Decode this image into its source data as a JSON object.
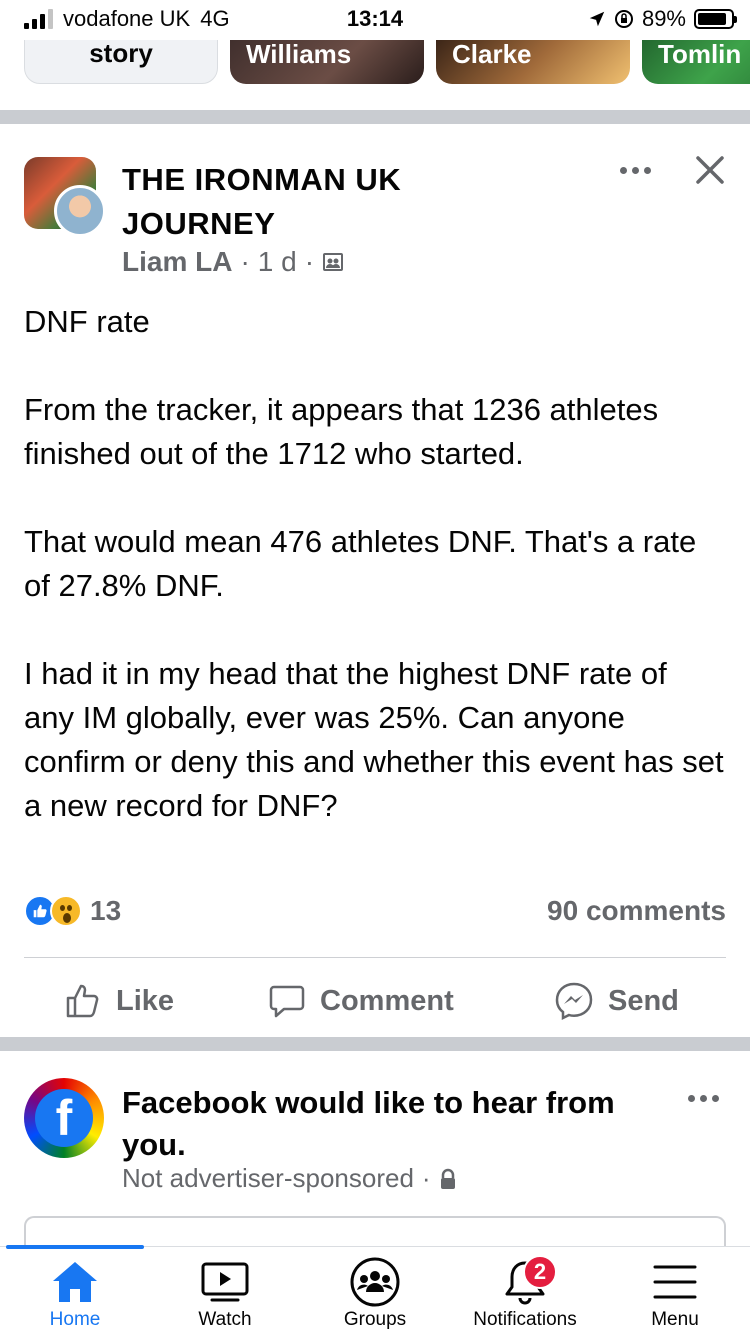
{
  "status_bar": {
    "carrier": "vodafone UK",
    "network": "4G",
    "time": "13:14",
    "battery_text": "89%",
    "battery_level": 0.89
  },
  "stories": [
    {
      "label": "story"
    },
    {
      "label": "Williams"
    },
    {
      "label": "Clarke"
    },
    {
      "label": "Tomlin"
    }
  ],
  "post": {
    "group_name": "THE IRONMAN UK JOURNEY",
    "author": "Liam LA",
    "time": "1 d",
    "separator": "·",
    "privacy_icon": "group-members-icon",
    "body": [
      "DNF rate",
      "From the tracker, it appears that 1236 athletes finished out of the 1712 who started.",
      "That would mean 476 athletes DNF. That's a rate of 27.8% DNF.",
      "I had it in my head that the highest DNF rate of any IM globally, ever was 25%. Can anyone confirm or deny this and whether this event has set a new record for DNF?"
    ],
    "reaction_count": "13",
    "comments_count": "90 comments",
    "actions": {
      "like": "Like",
      "comment": "Comment",
      "send": "Send"
    }
  },
  "survey_post": {
    "title": "Facebook would like to hear from you.",
    "subtitle": "Not advertiser-sponsored",
    "separator": "·",
    "avatar_badge": "PRIDE 2022"
  },
  "tabbar": {
    "home": "Home",
    "watch": "Watch",
    "groups": "Groups",
    "notifications": "Notifications",
    "notifications_badge": "2",
    "menu": "Menu"
  },
  "colors": {
    "accent": "#1877f2",
    "secondary_text": "#65676b",
    "badge": "#e41e3f"
  }
}
